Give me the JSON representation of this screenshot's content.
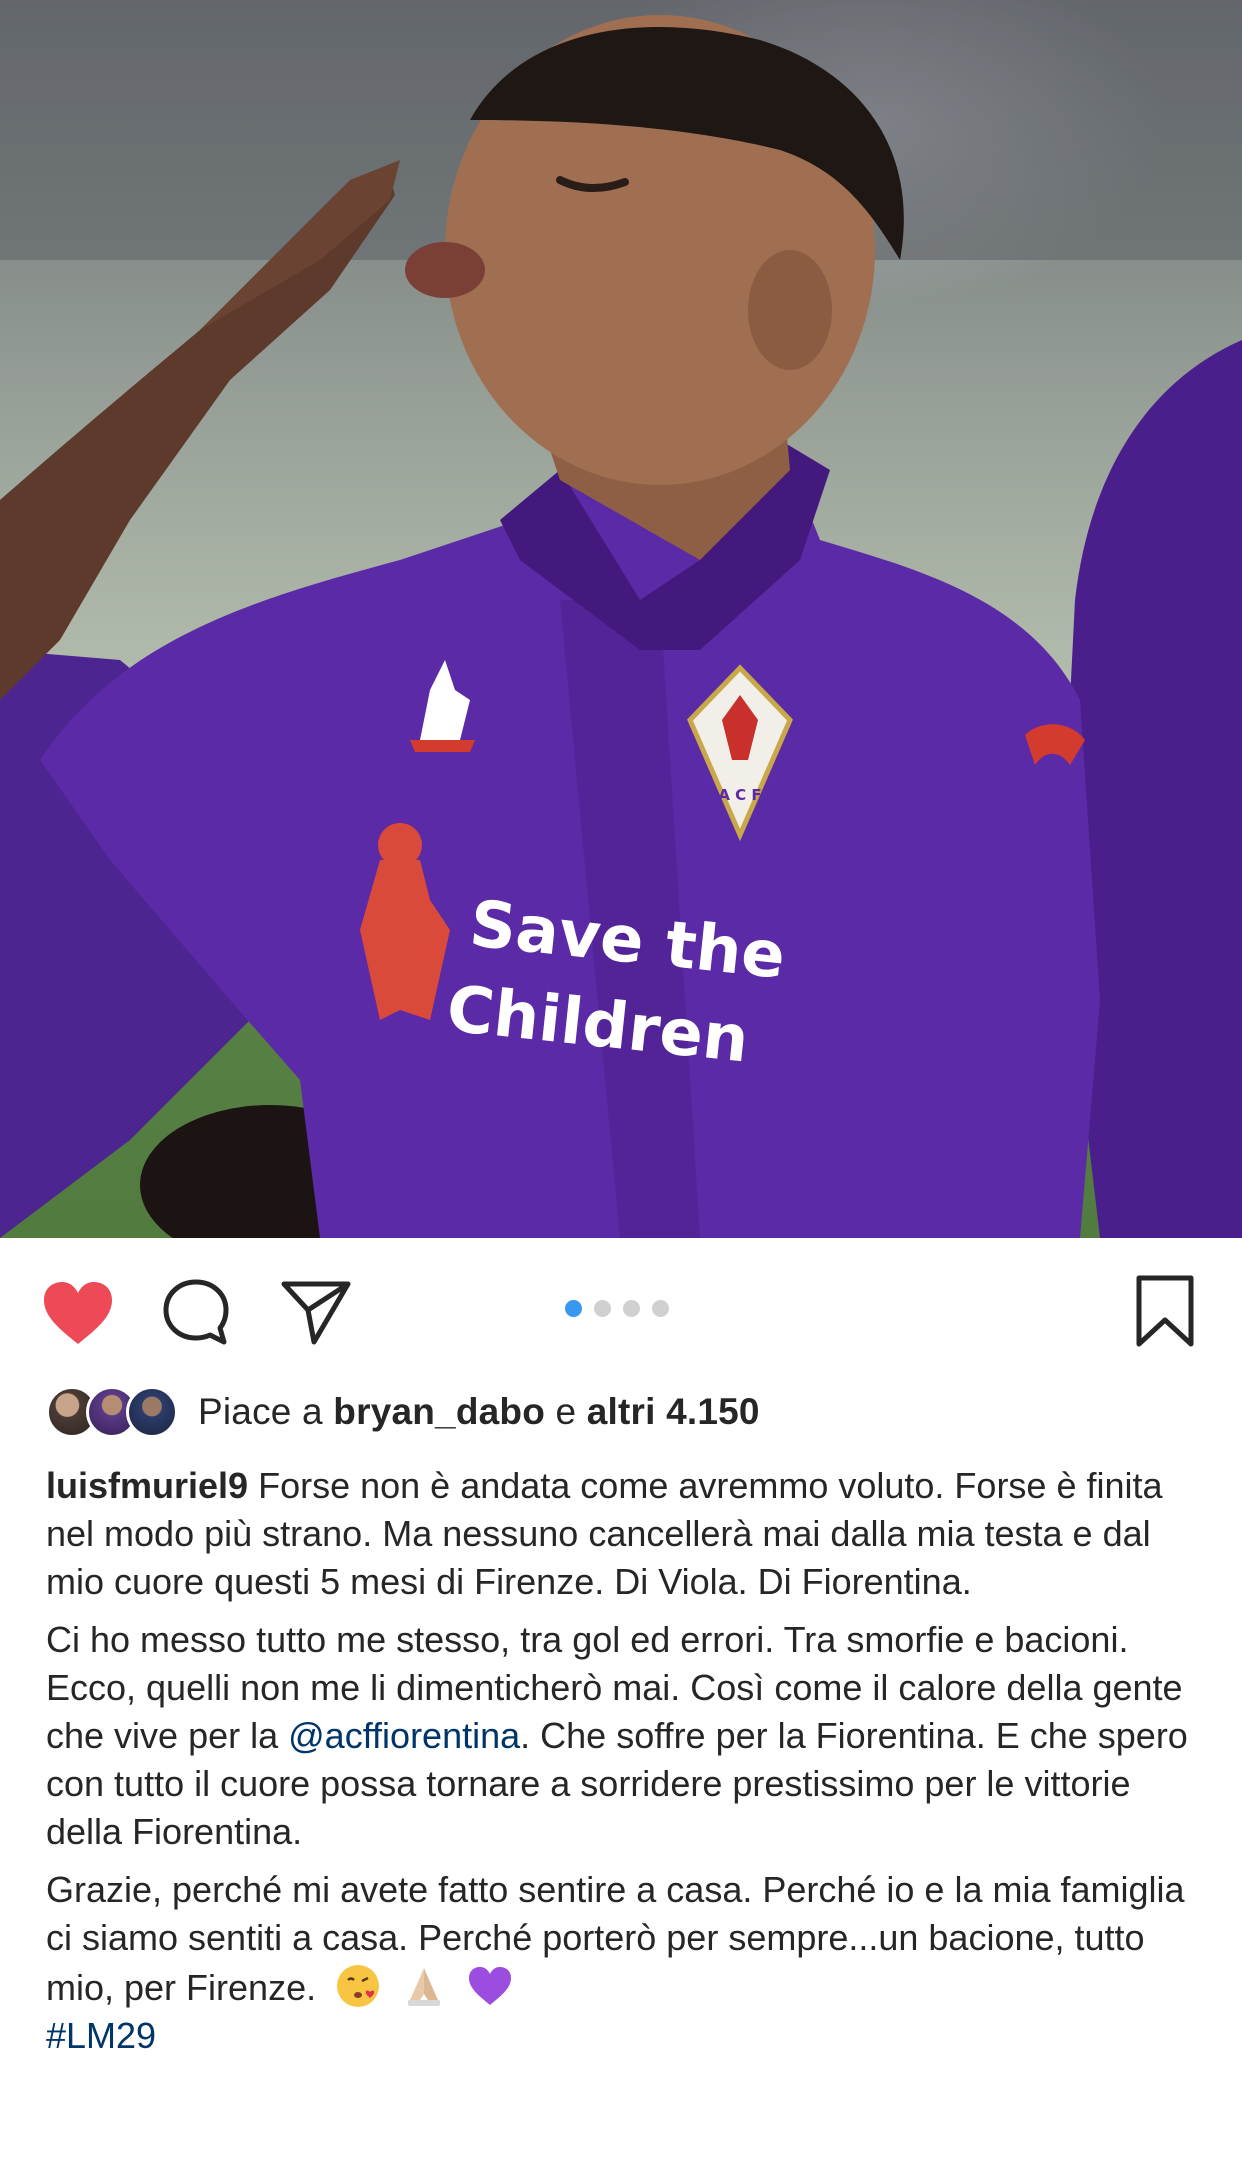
{
  "post": {
    "username": "luisfmuriel9",
    "liked": true,
    "carousel": {
      "total": 4,
      "active_index": 0
    },
    "likes": {
      "prefix": "Piace a",
      "first_user": "bryan_dabo",
      "connector": "e",
      "others": "altri 4.150"
    },
    "caption": {
      "p1": "Forse non è andata come avremmo voluto. Forse è finita nel modo più strano. Ma nessuno cancellerà mai dalla mia testa e dal mio cuore questi 5 mesi di Firenze. Di Viola. Di Fiorentina.",
      "p2_before": "Ci ho messo tutto me stesso, tra gol ed errori. Tra smorfie e bacioni. Ecco, quelli non me li dimenticherò mai. Così come il calore della gente che vive per la ",
      "p2_mention": "@acffiorentina",
      "p2_after": ". Che soffre per la Fiorentina. E che spero con tutto il cuore possa tornare a sorridere prestissimo per le vittorie della Fiorentina.",
      "p3": "Grazie, perché mi avete fatto sentire a casa. Perché io e la mia famiglia ci siamo sentiti a casa. Perché porterò per sempre...un bacione, tutto mio, per Firenze.",
      "emojis": [
        "kiss-face-icon",
        "praying-hands-icon",
        "purple-heart-icon"
      ],
      "hashtag": "#LM29"
    },
    "photo": {
      "jersey_text_line1": "Save the",
      "jersey_text_line2": "Children",
      "crest_letters": "A C F"
    }
  },
  "colors": {
    "like_red": "#ed4956",
    "link_blue": "#003569",
    "carousel_active": "#3897f0",
    "jersey_purple": "#5b2aa6"
  }
}
